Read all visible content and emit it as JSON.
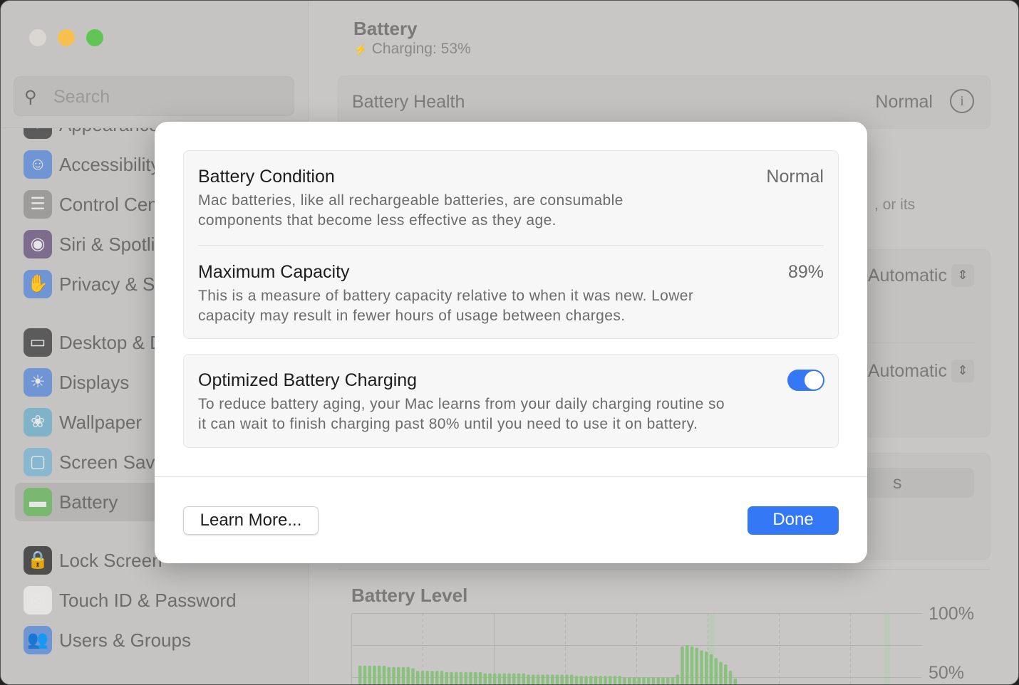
{
  "window": {
    "traffic_lights": {
      "close": "#dad7d3",
      "minimize": "#f5c04f",
      "zoom": "#61c554"
    }
  },
  "sidebar": {
    "search_placeholder": "Search",
    "items": [
      {
        "label": "Appearance",
        "icon": "appearance-icon",
        "color": "#5b5b5b"
      },
      {
        "label": "Accessibility",
        "icon": "accessibility-icon",
        "color": "#6f95d4"
      },
      {
        "label": "Control Centre",
        "icon": "control-centre-icon",
        "color": "#9d9c9b"
      },
      {
        "label": "Siri & Spotlight",
        "icon": "siri-icon",
        "color": "#7e6c8e"
      },
      {
        "label": "Privacy & Security",
        "icon": "hand-icon",
        "color": "#6f95d4"
      },
      {
        "label": "Desktop & Dock",
        "icon": "desktop-icon",
        "color": "#5b5b5b"
      },
      {
        "label": "Displays",
        "icon": "sun-icon",
        "color": "#6f95d4"
      },
      {
        "label": "Wallpaper",
        "icon": "wallpaper-icon",
        "color": "#7fb3c9"
      },
      {
        "label": "Screen Saver",
        "icon": "screen-saver-icon",
        "color": "#88b8cf"
      },
      {
        "label": "Battery",
        "icon": "battery-icon",
        "color": "#78b86f",
        "selected": true
      },
      {
        "label": "Lock Screen",
        "icon": "lock-icon",
        "color": "#4e4e4e"
      },
      {
        "label": "Touch ID & Password",
        "icon": "fingerprint-icon",
        "color": "#e6e4e3"
      },
      {
        "label": "Users & Groups",
        "icon": "users-icon",
        "color": "#6f95d4"
      }
    ]
  },
  "main": {
    "title": "Battery",
    "status": "Charging: 53%",
    "battery_health_label": "Battery Health",
    "battery_health_value": "Normal",
    "partial_text": ", or its",
    "dropdown_1": "Automatic",
    "dropdown_2": "Automatic",
    "partial_button": "s",
    "battery_level_title": "Battery Level"
  },
  "modal": {
    "condition": {
      "title": "Battery Condition",
      "value": "Normal",
      "desc1": "Mac batteries, like all rechargeable batteries, are consumable",
      "desc2": "components that become less effective as they age."
    },
    "capacity": {
      "title": "Maximum Capacity",
      "value": "89%",
      "desc1": "This is a measure of battery capacity relative to when it was new. Lower",
      "desc2": "capacity may result in fewer hours of usage between charges."
    },
    "optimized": {
      "title": "Optimized Battery Charging",
      "enabled": true,
      "desc1": "To reduce battery aging, your Mac learns from your daily charging routine so",
      "desc2": "it can wait to finish charging past 80% until you need to use it on battery."
    },
    "learn_more": "Learn More...",
    "done": "Done",
    "accent": "#3478f6"
  },
  "chart_data": {
    "type": "bar",
    "title": "Battery Level",
    "y_ticks": [
      "100%",
      "50%"
    ],
    "ylim": [
      0,
      100
    ],
    "values": [
      59,
      59,
      59,
      59,
      59,
      59,
      58,
      58,
      58,
      58,
      58,
      57,
      55,
      55,
      55,
      55,
      55,
      55,
      54,
      54,
      54,
      54,
      54,
      54,
      54,
      54,
      53,
      53,
      53,
      53,
      53,
      53,
      53,
      53,
      53,
      52,
      52,
      52,
      52,
      52,
      52,
      52,
      52,
      52,
      52,
      51,
      51,
      51,
      51,
      51,
      51,
      51,
      51,
      51,
      51,
      50,
      50,
      50,
      50,
      50,
      50,
      50,
      50,
      50,
      50,
      50,
      52,
      74,
      75,
      74,
      73,
      71,
      70,
      68,
      65,
      62,
      60,
      55,
      49
    ],
    "color": "#8bc17f"
  }
}
